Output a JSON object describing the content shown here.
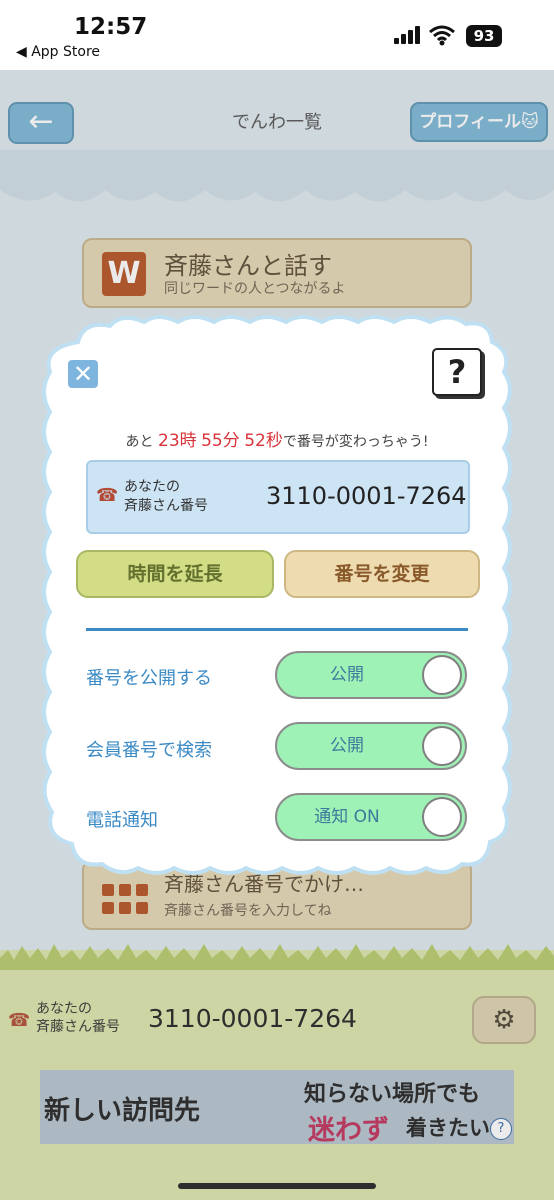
{
  "status_bar": {
    "time": "12:57",
    "back_app": "◀ App Store",
    "battery": "93"
  },
  "header": {
    "back_glyph": "←",
    "title": "でんわ一覧",
    "profile_label": "プロフィール🐱"
  },
  "background_options": [
    {
      "icon_letter": "W",
      "title": "斉藤さんと話す",
      "subtitle": "同じワードの人とつながるよ"
    },
    {
      "title": "斉藤さん番号でかけ…",
      "subtitle": "斉藤さん番号を入力してね"
    }
  ],
  "footer": {
    "label_line1": "あなたの",
    "label_line2": "斉藤さん番号",
    "number": "3110-0001-7264"
  },
  "ad": {
    "left_text": "新しい訪問先",
    "right_line1": "知らない場所でも",
    "right_highlight": "迷わず",
    "right_rest": "着きたい",
    "info": "?"
  },
  "modal": {
    "close_glyph": "✕",
    "help_glyph": "?",
    "countdown": {
      "prefix": "あと",
      "hours": "23",
      "h_unit": "時",
      "minutes": "55",
      "m_unit": "分",
      "seconds": "52",
      "s_unit": "秒",
      "suffix": "で番号が変わっちゃう!"
    },
    "number_box": {
      "label_line1": "あなたの",
      "label_line2": "斉藤さん番号",
      "number": "3110-0001-7264"
    },
    "extend_button": "時間を延長",
    "change_button": "番号を変更",
    "settings": [
      {
        "label": "番号を公開する",
        "toggle_text": "公開",
        "on": true
      },
      {
        "label": "会員番号で検索",
        "toggle_text": "公開",
        "on": true
      },
      {
        "label": "電話通知",
        "toggle_text": "通知 ON",
        "on": true
      }
    ]
  },
  "colors": {
    "accent_blue": "#3b8ac4",
    "countdown_red": "#d9333a",
    "toggle_on": "#9ef2b6"
  }
}
